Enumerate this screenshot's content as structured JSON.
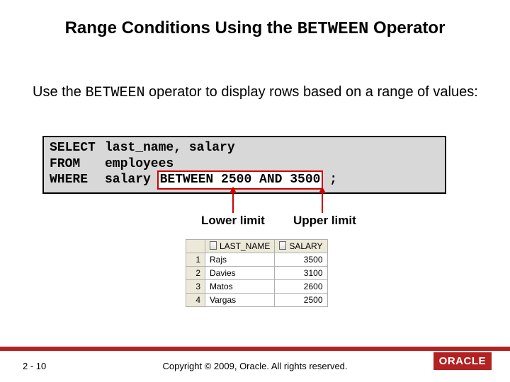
{
  "title_pre": "Range Conditions Using the ",
  "title_mono": "BETWEEN",
  "title_post": " Operator",
  "body_pre": "Use the ",
  "body_mono": "BETWEEN",
  "body_post": " operator to display rows based on a range of values:",
  "code": {
    "kw1": "SELECT",
    "l1": "last_name, salary",
    "kw2": "FROM",
    "l2": "employees",
    "kw3": "WHERE",
    "l3_pre": "salary ",
    "l3_hl": "BETWEEN 2500 AND 3500",
    "l3_post": " ;"
  },
  "labels": {
    "lower": "Lower limit",
    "upper": "Upper limit"
  },
  "chart_data": {
    "type": "table",
    "columns": [
      "LAST_NAME",
      "SALARY"
    ],
    "rows": [
      {
        "n": "1",
        "last_name": "Rajs",
        "salary": "3500"
      },
      {
        "n": "2",
        "last_name": "Davies",
        "salary": "3100"
      },
      {
        "n": "3",
        "last_name": "Matos",
        "salary": "2600"
      },
      {
        "n": "4",
        "last_name": "Vargas",
        "salary": "2500"
      }
    ]
  },
  "footer": {
    "page": "2 - 10",
    "copyright": "Copyright © 2009, Oracle. All rights reserved.",
    "logo": "ORACLE"
  }
}
